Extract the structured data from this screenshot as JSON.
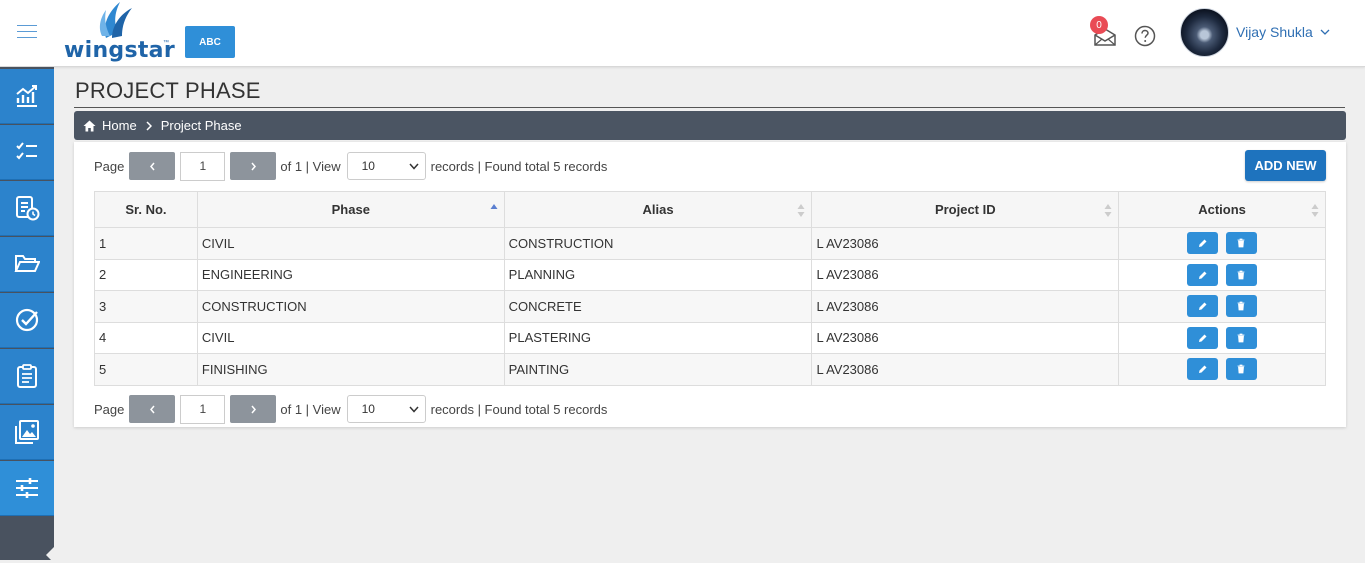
{
  "header": {
    "logo_text": "wingstar",
    "logo_tm": "™",
    "abc_label": "ABC",
    "mail_count": "0",
    "username": "Vijay Shukla"
  },
  "sidebar": {
    "items": [
      {
        "icon": "analytics-chart-icon"
      },
      {
        "icon": "checklist-icon"
      },
      {
        "icon": "report-clock-icon"
      },
      {
        "icon": "folder-open-icon"
      },
      {
        "icon": "check-circle-icon"
      },
      {
        "icon": "clipboard-icon"
      },
      {
        "icon": "gallery-icon"
      },
      {
        "icon": "sliders-icon"
      }
    ],
    "active_index": 7
  },
  "page": {
    "title": "PROJECT PHASE",
    "breadcrumb": {
      "home": "Home",
      "current": "Project Phase"
    }
  },
  "pager": {
    "page_label": "Page",
    "page_value": "1",
    "of_text": "of 1 | View",
    "view_value": "10",
    "records_text": "records | Found total 5 records"
  },
  "add_new_label": "ADD NEW",
  "table": {
    "headers": [
      "Sr. No.",
      "Phase",
      "Alias",
      "Project ID",
      "Actions"
    ],
    "rows": [
      {
        "sr": "1",
        "phase": "CIVIL",
        "alias": "CONSTRUCTION",
        "project_id": "L AV23086"
      },
      {
        "sr": "2",
        "phase": "ENGINEERING",
        "alias": "PLANNING",
        "project_id": "L AV23086"
      },
      {
        "sr": "3",
        "phase": "CONSTRUCTION",
        "alias": "CONCRETE",
        "project_id": "L AV23086"
      },
      {
        "sr": "4",
        "phase": "CIVIL",
        "alias": "PLASTERING",
        "project_id": "L AV23086"
      },
      {
        "sr": "5",
        "phase": "FINISHING",
        "alias": "PAINTING",
        "project_id": "L AV23086"
      }
    ]
  },
  "colors": {
    "accent": "#2f8fd8",
    "sidebar_bg": "#49525f",
    "breadcrumb_bg": "#4b5563",
    "badge": "#e94b55"
  }
}
